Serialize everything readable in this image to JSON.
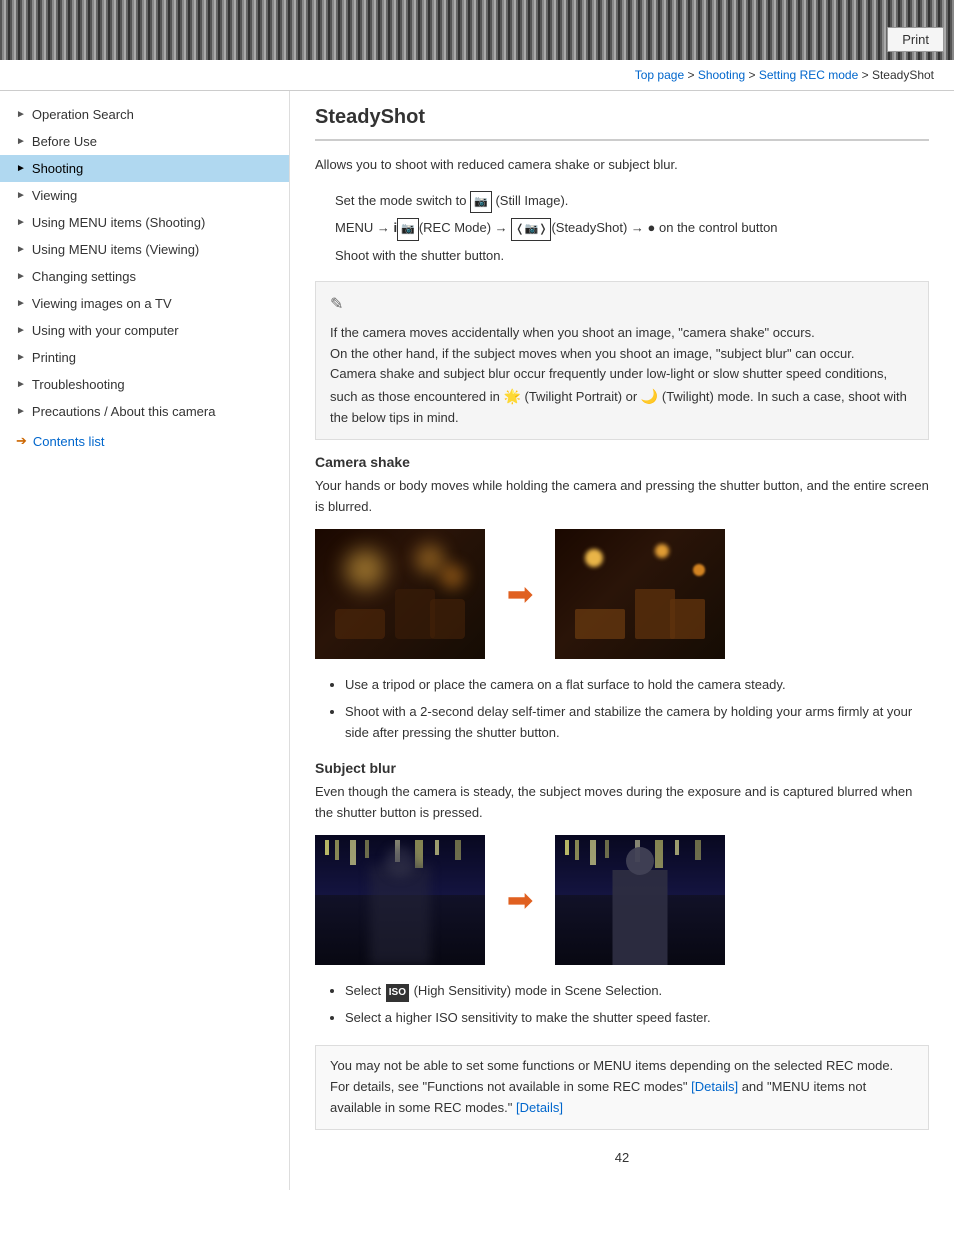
{
  "header": {
    "print_label": "Print"
  },
  "breadcrumb": {
    "top_page": "Top page",
    "separator1": " > ",
    "shooting": "Shooting",
    "separator2": " > ",
    "setting_rec": "Setting REC mode",
    "separator3": " > ",
    "steadyshot": "SteadyShot"
  },
  "sidebar": {
    "items": [
      {
        "id": "operation-search",
        "label": "Operation Search",
        "active": false
      },
      {
        "id": "before-use",
        "label": "Before Use",
        "active": false
      },
      {
        "id": "shooting",
        "label": "Shooting",
        "active": true
      },
      {
        "id": "viewing",
        "label": "Viewing",
        "active": false
      },
      {
        "id": "using-menu-shooting",
        "label": "Using MENU items (Shooting)",
        "active": false
      },
      {
        "id": "using-menu-viewing",
        "label": "Using MENU items (Viewing)",
        "active": false
      },
      {
        "id": "changing-settings",
        "label": "Changing settings",
        "active": false
      },
      {
        "id": "viewing-images-tv",
        "label": "Viewing images on a TV",
        "active": false
      },
      {
        "id": "using-computer",
        "label": "Using with your computer",
        "active": false
      },
      {
        "id": "printing",
        "label": "Printing",
        "active": false
      },
      {
        "id": "troubleshooting",
        "label": "Troubleshooting",
        "active": false
      },
      {
        "id": "precautions",
        "label": "Precautions / About this camera",
        "active": false
      }
    ],
    "contents_link": "Contents list"
  },
  "main": {
    "page_title": "SteadyShot",
    "intro": "Allows you to shoot with reduced camera shake or subject blur.",
    "instruction1": "Set the mode switch to 📷 (Still Image).",
    "instruction2": "MENU → i📷(REC Mode) → ‹📷›(SteadyShot) → ●  on the control button",
    "instruction3": "Shoot with the shutter button.",
    "note_text": "If the camera moves accidentally when you shoot an image, “camera shake” occurs.\nOn the other hand, if the subject moves when you shoot an image, “subject blur” can occur.\nCamera shake and subject blur occur frequently under low-light or slow shutter speed conditions, such as those encountered in 🌟 (Twilight Portrait) or 🌙 (Twilight) mode. In such a case, shoot with the below tips in mind.",
    "camera_shake_heading": "Camera shake",
    "camera_shake_text": "Your hands or body moves while holding the camera and pressing the shutter button, and the entire screen is blurred.",
    "camera_shake_bullets": [
      "Use a tripod or place the camera on a flat surface to hold the camera steady.",
      "Shoot with a 2-second delay self-timer and stabilize the camera by holding your arms firmly at your side after pressing the shutter button."
    ],
    "subject_blur_heading": "Subject blur",
    "subject_blur_text": "Even though the camera is steady, the subject moves during the exposure and is captured blurred when the shutter button is pressed.",
    "subject_blur_bullets": [
      "Select ISO (High Sensitivity) mode in Scene Selection.",
      "Select a higher ISO sensitivity to make the shutter speed faster."
    ],
    "note_bottom": "You may not be able to set some functions or MENU items depending on the selected REC mode. For details, see “Functions not available in some REC modes” [Details] and “MENU items not available in some REC modes.” [Details]",
    "details_link1": "[Details]",
    "details_link2": "[Details]",
    "page_number": "42"
  }
}
